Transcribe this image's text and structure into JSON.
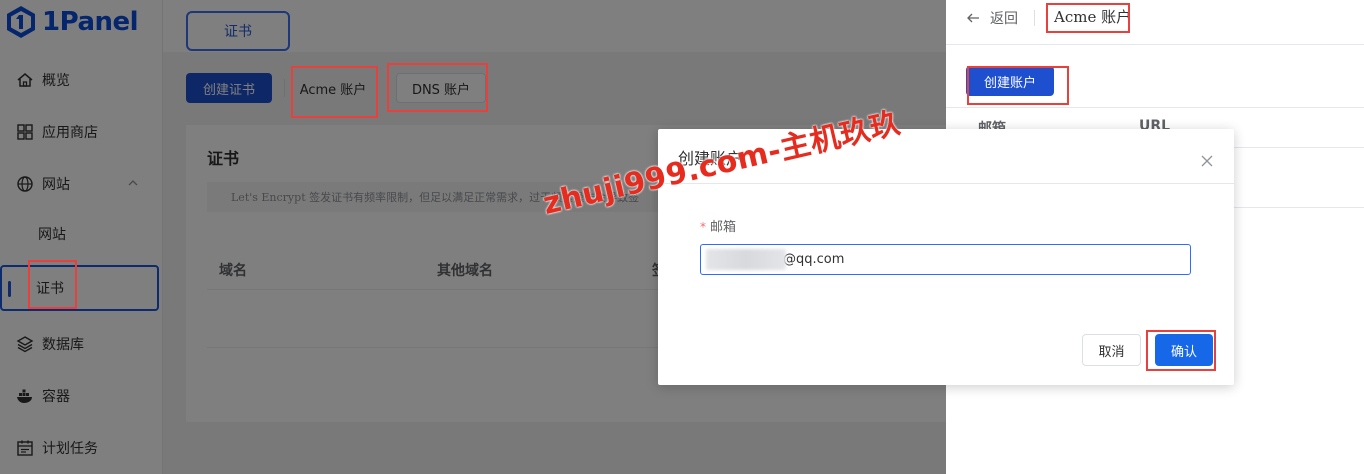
{
  "app": {
    "logo_text": "1Panel"
  },
  "sidebar": {
    "items": [
      {
        "label": "概览"
      },
      {
        "label": "应用商店"
      },
      {
        "label": "网站"
      },
      {
        "label": "网站"
      },
      {
        "label": "证书"
      },
      {
        "label": "数据库"
      },
      {
        "label": "容器"
      },
      {
        "label": "计划任务"
      }
    ]
  },
  "header": {
    "tab_label": "证书"
  },
  "toolbar": {
    "create_cert": "创建证书",
    "acme_account": "Acme 账户",
    "dns_account": "DNS 账户"
  },
  "cert_panel": {
    "title": "证书",
    "notice": "Let's Encrypt 签发证书有频率限制，但足以满足正常需求，过于频繁操作会导致签",
    "columns": [
      "域名",
      "其他域名",
      "签"
    ]
  },
  "drawer": {
    "back_label": "返回",
    "title": "Acme 账户",
    "create_account": "创建账户",
    "columns": [
      "邮箱",
      "URL"
    ]
  },
  "dialog": {
    "title": "创建账户",
    "field_label": "邮箱",
    "email_value": "@qq.com",
    "cancel": "取消",
    "confirm": "确认"
  },
  "watermark": "zhuji999.com-主机玖玖",
  "colors": {
    "primary": "#1d4fcf",
    "annotation_red": "#e8403c",
    "watermark_red": "#e62b1f"
  }
}
